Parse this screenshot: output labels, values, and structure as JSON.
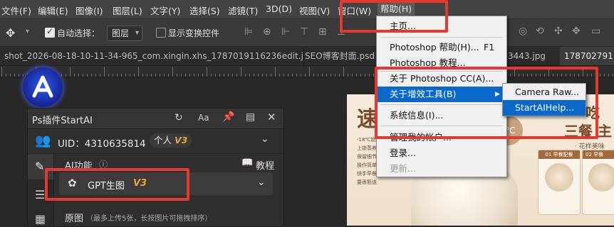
{
  "menubar": {
    "items": [
      "文件(F)",
      "编辑(E)",
      "图像(I)",
      "图层(L)",
      "文字(Y)",
      "选择(S)",
      "滤镜(T)",
      "3D(D)",
      "视图(V)",
      "窗口(W)",
      "帮助(H)"
    ]
  },
  "options": {
    "auto_select_label": "自动选择：",
    "auto_select_checked": true,
    "layer_select_value": "图层",
    "show_transform_label": "显示变换控件",
    "show_transform_checked": false
  },
  "tabs": [
    {
      "label": "shot_2026-08-18-10-11-34-965_com.xingin.xhs_1787019116236edit.jpg"
    },
    {
      "label": "SEO博客封面.psd"
    },
    {
      "label": "3443.jpg"
    },
    {
      "label": "178702791"
    }
  ],
  "help_menu": {
    "items": [
      {
        "label": "主页...",
        "shortcut": ""
      },
      {
        "label": "Photoshop 帮助(H)...",
        "shortcut": "F1"
      },
      {
        "label": "Photoshop 教程...",
        "shortcut": ""
      },
      {
        "label": "关于 Photoshop CC(A)...",
        "shortcut": ""
      },
      {
        "label": "关于增效工具(B)",
        "shortcut": ""
      },
      {
        "label": "系统信息(I)...",
        "shortcut": ""
      },
      {
        "label": "管理我的帐户...",
        "shortcut": ""
      },
      {
        "label": "登录...",
        "shortcut": ""
      },
      {
        "label": "更新...",
        "shortcut": ""
      }
    ]
  },
  "plugins_submenu": {
    "items": [
      {
        "label": "Camera Raw..."
      },
      {
        "label": "StartAIHelp..."
      }
    ]
  },
  "panel": {
    "title": "Ps插件StartAI",
    "uid_text": "UID：4310635814",
    "plan_label": "个人",
    "plan_badge": "V3",
    "section_title": "AI功能",
    "tutorial_label": "教程",
    "feature_label": "GPT生图",
    "feature_badge": "V3",
    "original_label": "原图",
    "original_hint": "（最多上传5张，长按图片可拖拽排序）",
    "header_icon_text": "Aa"
  },
  "document": {
    "headline_left": "速",
    "headline_right_top": "吃",
    "headline_right_mid": "三餐 主",
    "caption_right": "· 花样美味",
    "small_lines": [
      "-18℃锁鲜",
      "上锁蒸养",
      "保留细节",
      "操作简单",
      "快手早餐",
      "要香筋道"
    ],
    "badge_temp": "3℃",
    "card_left": "01 早餐配餐",
    "card_right": "02 早餐"
  },
  "colors": {
    "accent_red": "#e23a2e",
    "menu_highlight": "#0a68c9",
    "badge_gold": "#e8a53a"
  }
}
